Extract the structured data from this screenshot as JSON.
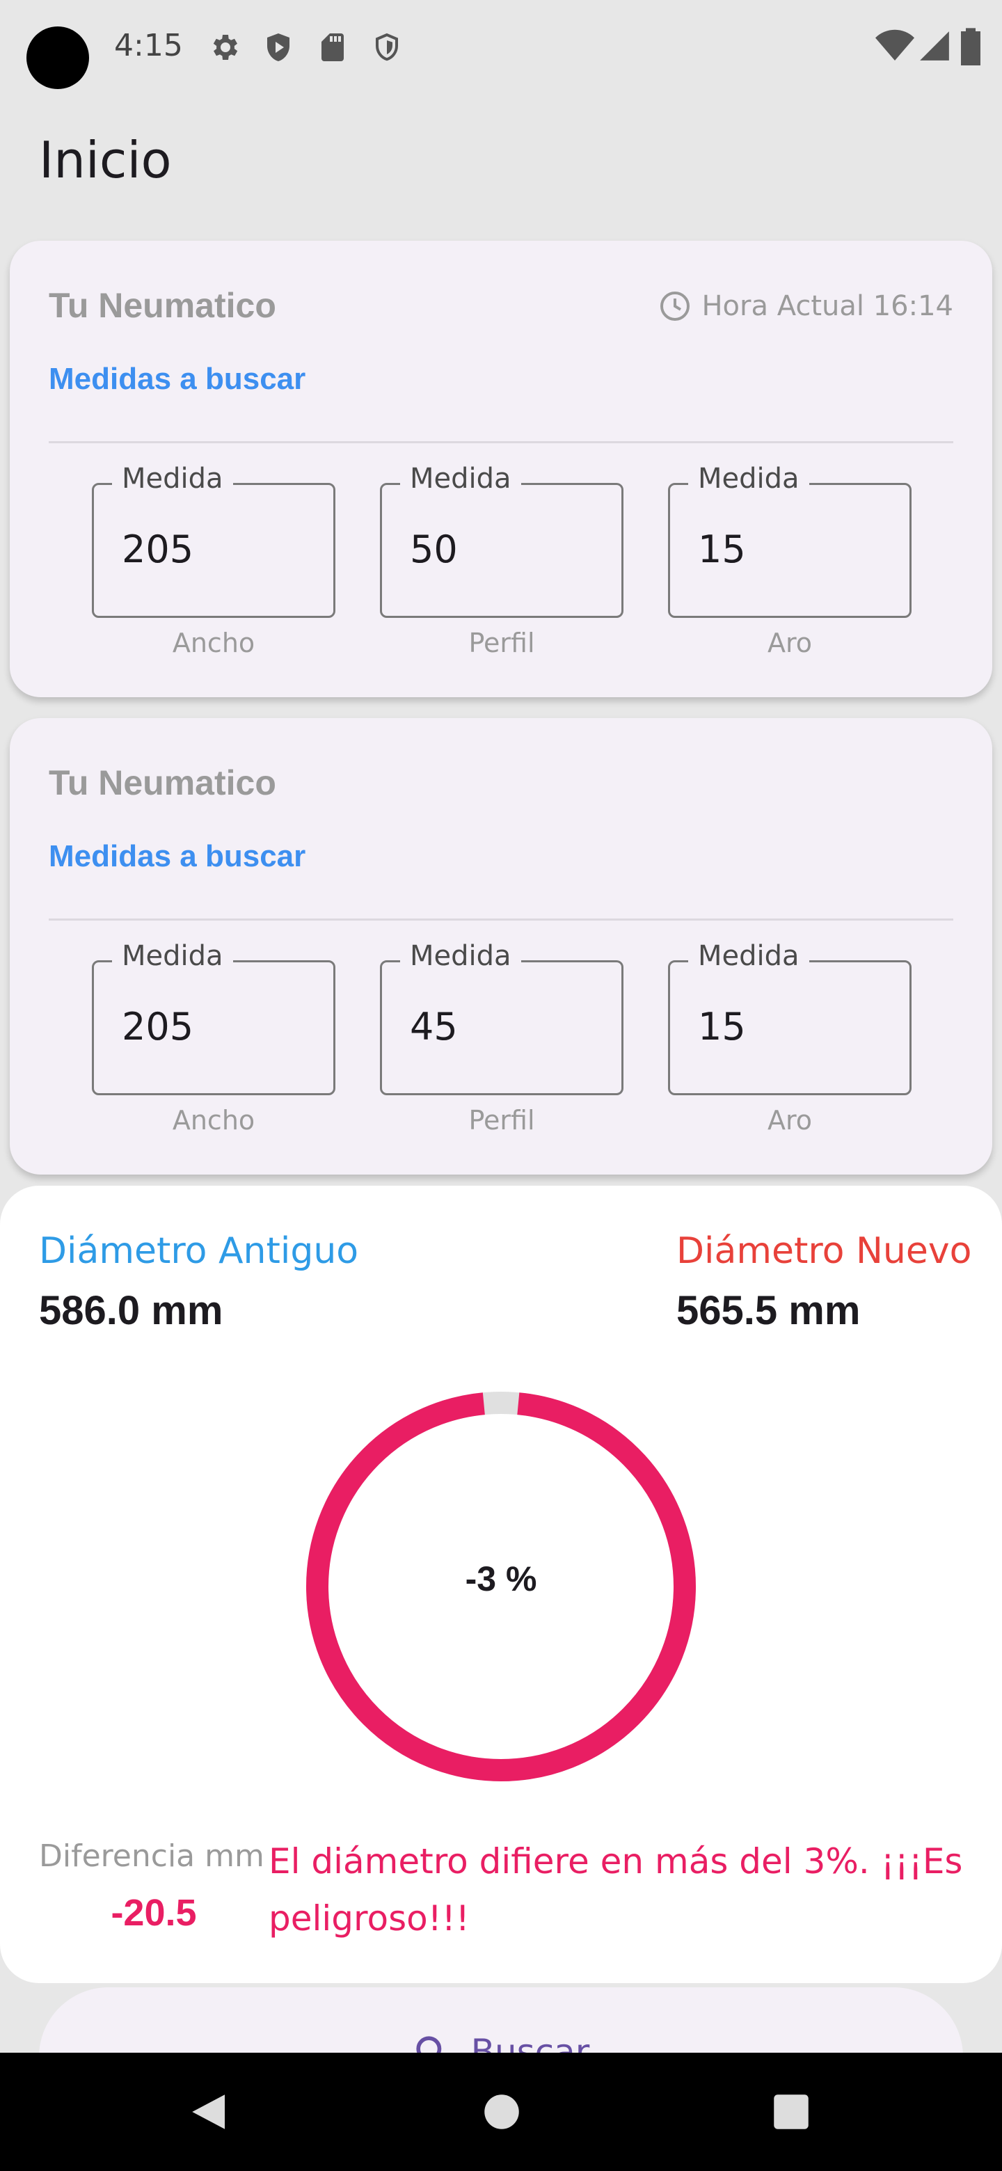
{
  "status_bar": {
    "time": "4:15"
  },
  "app_bar": {
    "title": "Inicio"
  },
  "card_original": {
    "title": "Tu Neumatico",
    "hora_label": "Hora Actual 16:14",
    "subtitle": "Medidas a buscar",
    "fields": [
      {
        "legend": "Medida",
        "value": "205",
        "helper": "Ancho"
      },
      {
        "legend": "Medida",
        "value": "50",
        "helper": "Perfil"
      },
      {
        "legend": "Medida",
        "value": "15",
        "helper": "Aro"
      }
    ]
  },
  "card_new": {
    "title": "Tu Neumatico",
    "subtitle": "Medidas a buscar",
    "fields": [
      {
        "legend": "Medida",
        "value": "205",
        "helper": "Ancho"
      },
      {
        "legend": "Medida",
        "value": "45",
        "helper": "Perfil"
      },
      {
        "legend": "Medida",
        "value": "15",
        "helper": "Aro"
      }
    ]
  },
  "result": {
    "old_label": "Diámetro Antiguo",
    "old_value": "586.0 mm",
    "new_label": "Diámetro Nuevo",
    "new_value": "565.5 mm",
    "gauge_text": "-3 %",
    "gauge_fraction": 0.97,
    "diff_label": "Diferencia mm",
    "diff_value": "-20.5",
    "warning": "El diámetro difiere en más del 3%. ¡¡¡Es peligroso!!!"
  },
  "search_button": {
    "label": "Buscar"
  },
  "colors": {
    "accent_blue": "#3d8ff0",
    "old_label": "#2e9be6",
    "new_label": "#e8413a",
    "danger": "#e91e63",
    "primary": "#6750a4",
    "card_bg": "#f4f0f7"
  }
}
